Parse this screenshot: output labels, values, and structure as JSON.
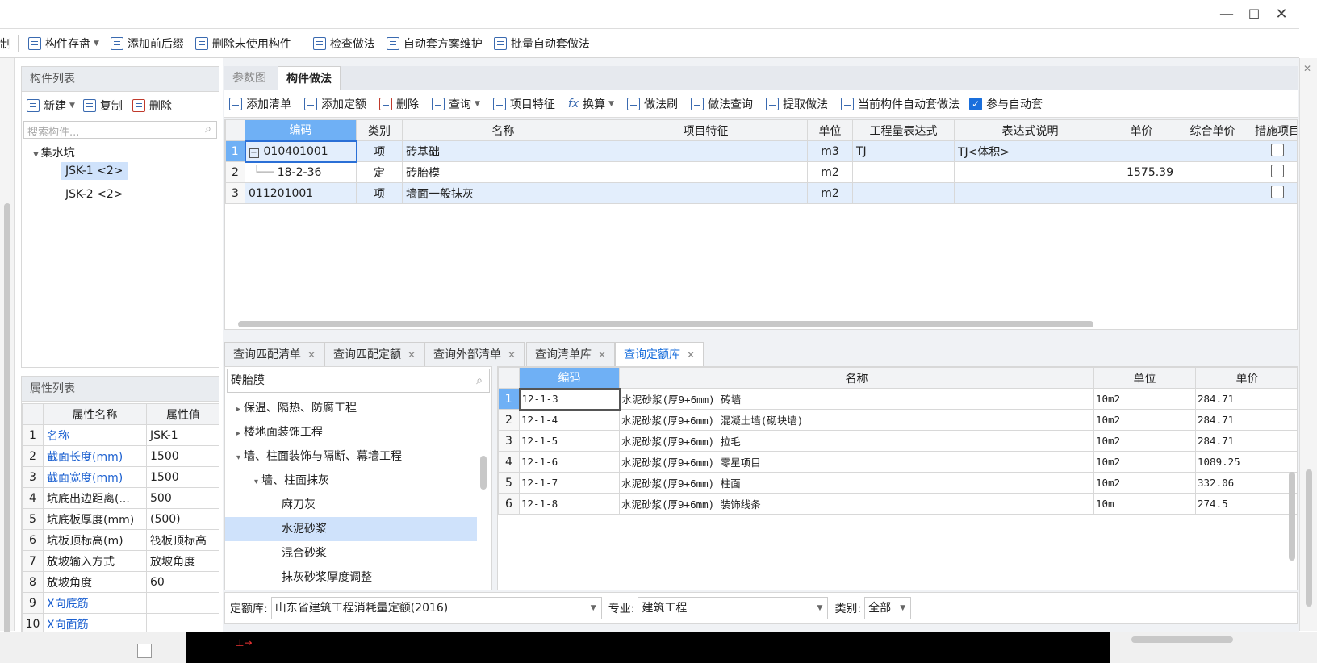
{
  "window": {
    "min": "—",
    "max": "☐",
    "close": "✕"
  },
  "toolbar": {
    "items": [
      "制",
      "构件存盘",
      "添加前后缀",
      "删除未使用构件",
      "检查做法",
      "自动套方案维护",
      "批量自动套做法"
    ]
  },
  "component_list": {
    "title": "构件列表",
    "new_label": "新建",
    "copy_label": "复制",
    "delete_label": "删除",
    "search_placeholder": "搜索构件...",
    "tree": {
      "root": "集水坑",
      "items": [
        "JSK-1 <2>",
        "JSK-2 <2>"
      ]
    }
  },
  "property_list": {
    "title": "属性列表",
    "headers": [
      "属性名称",
      "属性值"
    ],
    "rows": [
      {
        "n": "1",
        "name": "名称",
        "value": "JSK-1"
      },
      {
        "n": "2",
        "name": "截面长度(mm)",
        "value": "1500"
      },
      {
        "n": "3",
        "name": "截面宽度(mm)",
        "value": "1500"
      },
      {
        "n": "4",
        "name": "坑底出边距离(...",
        "value": "500"
      },
      {
        "n": "5",
        "name": "坑底板厚度(mm)",
        "value": "(500)"
      },
      {
        "n": "6",
        "name": "坑板顶标高(m)",
        "value": "筏板顶标高"
      },
      {
        "n": "7",
        "name": "放坡输入方式",
        "value": "放坡角度"
      },
      {
        "n": "8",
        "name": "放坡角度",
        "value": "60"
      },
      {
        "n": "9",
        "name": "X向底筋",
        "value": ""
      },
      {
        "n": "10",
        "name": "X向面筋",
        "value": ""
      }
    ]
  },
  "method": {
    "tabs": [
      "参数图",
      "构件做法"
    ],
    "actions": [
      "添加清单",
      "添加定额",
      "删除",
      "查询",
      "项目特征",
      "换算",
      "做法刷",
      "做法查询",
      "提取做法",
      "当前构件自动套做法"
    ],
    "auto_label": "参与自动套",
    "headers": [
      "编码",
      "类别",
      "名称",
      "项目特征",
      "单位",
      "工程量表达式",
      "表达式说明",
      "单价",
      "综合单价",
      "措施项目"
    ],
    "rows": [
      {
        "n": "1",
        "code": "010401001",
        "type": "项",
        "name": "砖基础",
        "feature": "",
        "unit": "m3",
        "expr": "TJ",
        "desc": "TJ<体积>",
        "price": "",
        "total": ""
      },
      {
        "n": "2",
        "code": "18-2-36",
        "type": "定",
        "name": "砖胎模",
        "feature": "",
        "unit": "m2",
        "expr": "",
        "desc": "",
        "price": "1575.39",
        "total": ""
      },
      {
        "n": "3",
        "code": "011201001",
        "type": "项",
        "name": "墙面一般抹灰",
        "feature": "",
        "unit": "m2",
        "expr": "",
        "desc": "",
        "price": "",
        "total": ""
      }
    ]
  },
  "query": {
    "tabs": [
      "查询匹配清单",
      "查询匹配定额",
      "查询外部清单",
      "查询清单库",
      "查询定额库"
    ],
    "active_tab": "查询定额库",
    "search_value": "砖胎膜",
    "tree": [
      "保温、隔热、防腐工程",
      "楼地面装饰工程",
      "墙、柱面装饰与隔断、幕墙工程",
      "墙、柱面抹灰",
      "麻刀灰",
      "水泥砂浆",
      "混合砂浆",
      "抹灰砂浆厚度调整"
    ],
    "headers": [
      "编码",
      "名称",
      "单位",
      "单价"
    ],
    "rows": [
      {
        "n": "1",
        "code": "12-1-3",
        "name": "水泥砂浆(厚9+6mm) 砖墙",
        "unit": "10m2",
        "price": "284.71"
      },
      {
        "n": "2",
        "code": "12-1-4",
        "name": "水泥砂浆(厚9+6mm) 混凝土墙(砌块墙)",
        "unit": "10m2",
        "price": "284.71"
      },
      {
        "n": "3",
        "code": "12-1-5",
        "name": "水泥砂浆(厚9+6mm) 拉毛",
        "unit": "10m2",
        "price": "284.71"
      },
      {
        "n": "4",
        "code": "12-1-6",
        "name": "水泥砂浆(厚9+6mm) 零星项目",
        "unit": "10m2",
        "price": "1089.25"
      },
      {
        "n": "5",
        "code": "12-1-7",
        "name": "水泥砂浆(厚9+6mm) 柱面",
        "unit": "10m2",
        "price": "332.06"
      },
      {
        "n": "6",
        "code": "12-1-8",
        "name": "水泥砂浆(厚9+6mm) 装饰线条",
        "unit": "10m",
        "price": "274.5"
      }
    ],
    "library_label": "定额库:",
    "library_value": "山东省建筑工程消耗量定额(2016)",
    "major_label": "专业:",
    "major_value": "建筑工程",
    "category_label": "类别:",
    "category_value": "全部"
  }
}
